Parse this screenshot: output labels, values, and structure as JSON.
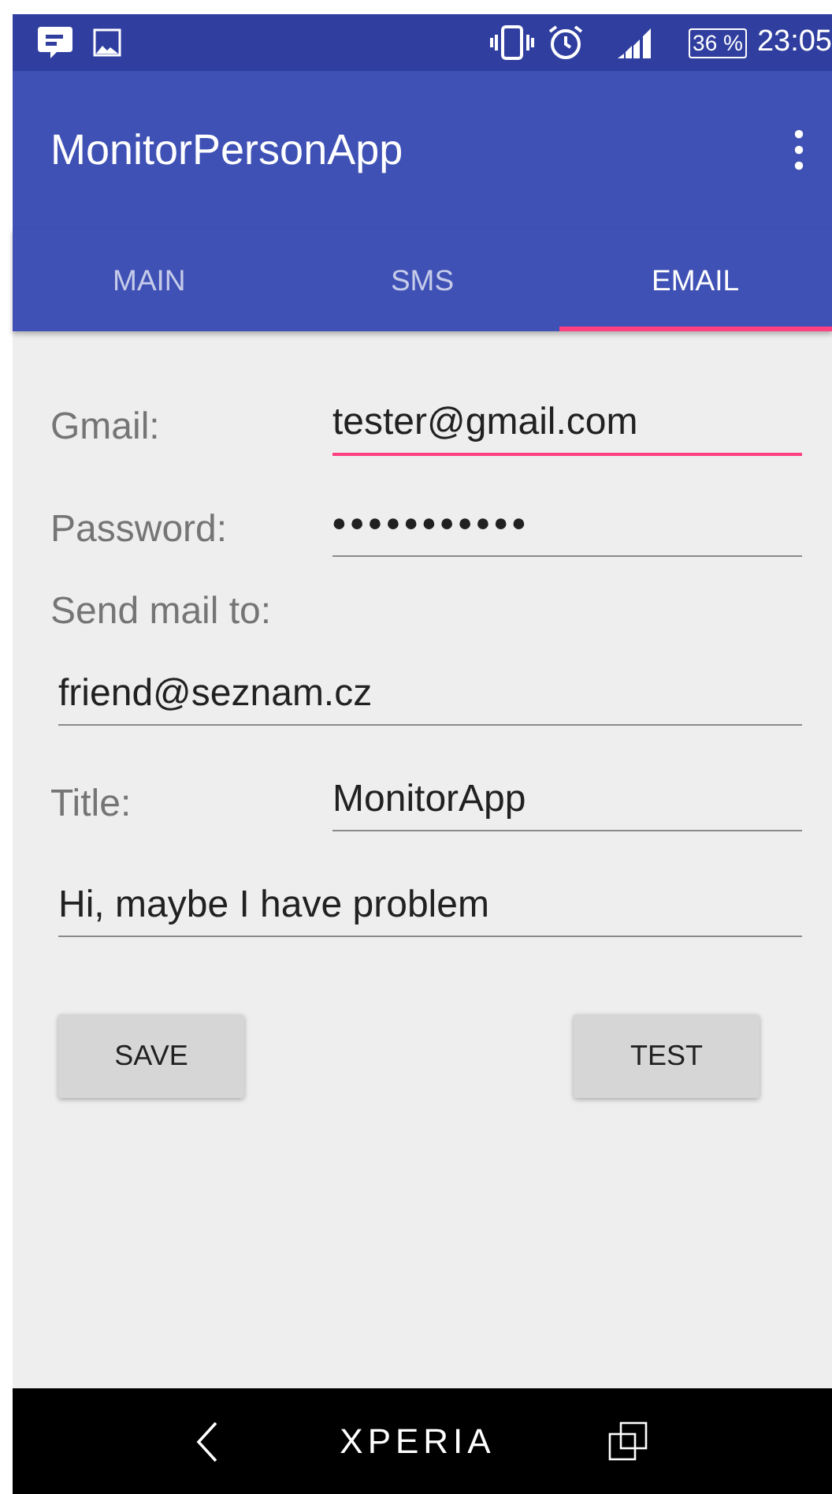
{
  "status_bar": {
    "battery": "36 %",
    "time": "23:05"
  },
  "app_bar": {
    "title": "MonitorPersonApp"
  },
  "tabs": [
    {
      "label": "MAIN",
      "selected": false
    },
    {
      "label": "SMS",
      "selected": false
    },
    {
      "label": "EMAIL",
      "selected": true
    }
  ],
  "form": {
    "rows": [
      {
        "kind": "inline",
        "label": "Gmail:",
        "value": "tester@gmail.com",
        "focused": true
      },
      {
        "kind": "inline",
        "label": "Password:",
        "value": "•••••••••••",
        "focused": false
      },
      {
        "kind": "heading",
        "label": "Send mail to:"
      },
      {
        "kind": "full",
        "value": "friend@seznam.cz",
        "focused": false
      },
      {
        "kind": "inline",
        "label": "Title:",
        "value": "MonitorApp",
        "focused": false
      },
      {
        "kind": "full",
        "value": "Hi, maybe I have problem",
        "focused": false
      }
    ],
    "buttons": [
      "SAVE",
      "TEST"
    ]
  },
  "nav_bar": {
    "logo": "XPERIA"
  }
}
